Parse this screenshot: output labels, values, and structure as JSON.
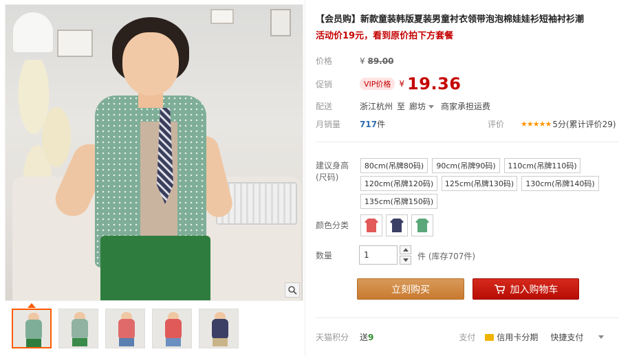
{
  "product": {
    "title": "【会员购】新款童装韩版夏装男童衬衣领带泡泡棉娃娃衫短袖衬衫潮",
    "promo": "活动价19元，看到原价拍下方套餐"
  },
  "price": {
    "label": "价格",
    "currency": "¥",
    "original": "89.00",
    "promo_label": "促销",
    "vip_tag": "VIP价格",
    "current": "19.36"
  },
  "shipping": {
    "label": "配送",
    "from": "浙江杭州",
    "to_word": "至",
    "to": "廊坊",
    "fee_text": "商家承担运费"
  },
  "sales": {
    "label": "月销量",
    "count": "717",
    "unit": "件"
  },
  "rating": {
    "label": "评价",
    "stars": "★★★★★",
    "score": "5分",
    "reviews": "(累计评价29)"
  },
  "sizes": {
    "label": "建议身高(尺码)",
    "options": [
      "80cm(吊牌80码)",
      "90cm(吊牌90码)",
      "110cm(吊牌110码)",
      "120cm(吊牌120码)",
      "125cm(吊牌130码)",
      "130cm(吊牌140码)",
      "135cm(吊牌150码)"
    ]
  },
  "colors": {
    "label": "颜色分类",
    "swatches": [
      "#e25a5a",
      "#3b3f66",
      "#5aa77a"
    ]
  },
  "quantity": {
    "label": "数量",
    "value": "1",
    "unit": "件",
    "stock": "(库存707件)"
  },
  "buttons": {
    "buy_now": "立刻购买",
    "add_to_cart": "加入购物车"
  },
  "bottom": {
    "points_label": "天猫积分",
    "points_prefix": "送",
    "points_value": "9",
    "pay_label": "支付",
    "card_installment": "信用卡分期",
    "quick_pay": "快捷支付"
  },
  "colors_theme": {
    "price_red": "#c40000",
    "buy_orange": "#c97a2f",
    "cart_red": "#b80d04",
    "active_thumb": "#ff5a00"
  }
}
